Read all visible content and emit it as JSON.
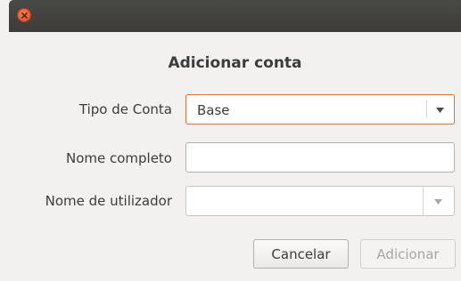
{
  "window": {
    "close_icon": "close-icon"
  },
  "dialog": {
    "title": "Adicionar conta",
    "account_type": {
      "label": "Tipo de Conta",
      "value": "Base"
    },
    "full_name": {
      "label": "Nome completo",
      "value": ""
    },
    "username": {
      "label": "Nome de utilizador",
      "value": ""
    },
    "buttons": {
      "cancel": "Cancelar",
      "add": "Adicionar"
    }
  },
  "colors": {
    "accent": "#e06d3e",
    "titlebar": "#3c3b37",
    "background": "#f2f1f0"
  }
}
